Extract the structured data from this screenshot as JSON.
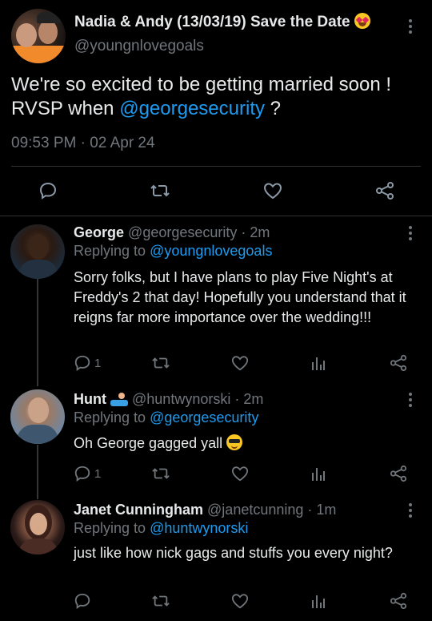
{
  "main_tweet": {
    "author_name": "Nadia & Andy (13/03/19) Save the Date",
    "author_emoji": "heart-eyes-emoji",
    "handle": "@youngnlovegoals",
    "text_before_mention": "We're so excited to be getting married soon ! RVSP when ",
    "mention": "@georgesecurity",
    "text_after_mention": " ?",
    "timestamp": "09:53 PM · 02 Apr 24"
  },
  "replies": [
    {
      "name": "George",
      "handle": "@georgesecurity",
      "time": "· 2m",
      "replying_label": "Replying to ",
      "replying_to": "@youngnlovegoals",
      "text": "Sorry folks, but I have plans to play Five Night's at Freddy's 2 that day! Hopefully you understand that it reigns far more importance over the wedding!!!",
      "reply_count": "1"
    },
    {
      "name": "Hunt",
      "name_emoji": "swimmer-emoji",
      "handle": "@huntwynorski",
      "time": "· 2m",
      "replying_label": "Replying to ",
      "replying_to": "@georgesecurity",
      "text": "Oh George gagged yall",
      "text_emoji": "sunglasses-emoji",
      "reply_count": "1"
    },
    {
      "name": "Janet Cunningham",
      "handle": "@janetcunning",
      "time": "· 1m",
      "replying_label": "Replying to ",
      "replying_to": "@huntwynorski",
      "text": "just like how nick gags and stuffs you every night?",
      "reply_count": ""
    }
  ],
  "colors": {
    "background": "#000000",
    "text": "#e7e9ea",
    "muted": "#71767b",
    "link": "#1d9bf0",
    "divider": "#2f3336"
  }
}
